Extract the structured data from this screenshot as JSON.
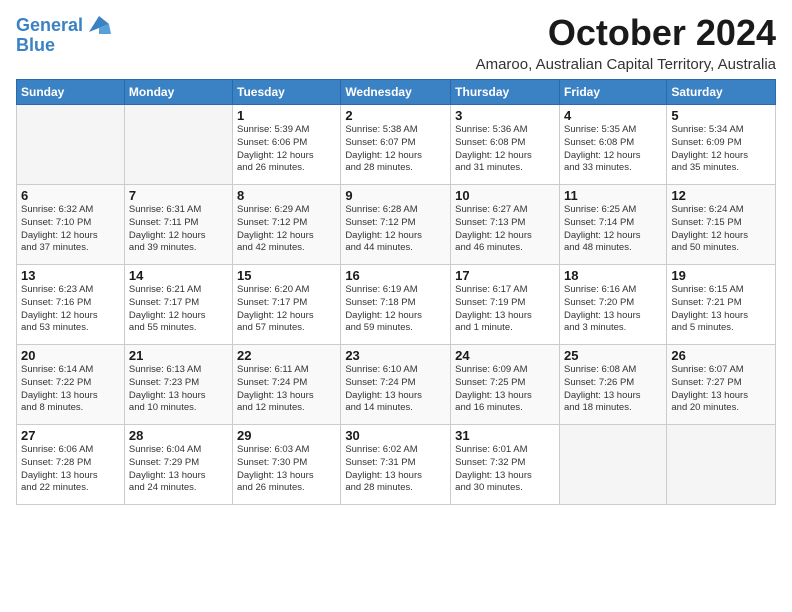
{
  "logo": {
    "line1": "General",
    "line2": "Blue"
  },
  "title": "October 2024",
  "subtitle": "Amaroo, Australian Capital Territory, Australia",
  "days_header": [
    "Sunday",
    "Monday",
    "Tuesday",
    "Wednesday",
    "Thursday",
    "Friday",
    "Saturday"
  ],
  "weeks": [
    [
      {
        "num": "",
        "info": ""
      },
      {
        "num": "",
        "info": ""
      },
      {
        "num": "1",
        "info": "Sunrise: 5:39 AM\nSunset: 6:06 PM\nDaylight: 12 hours\nand 26 minutes."
      },
      {
        "num": "2",
        "info": "Sunrise: 5:38 AM\nSunset: 6:07 PM\nDaylight: 12 hours\nand 28 minutes."
      },
      {
        "num": "3",
        "info": "Sunrise: 5:36 AM\nSunset: 6:08 PM\nDaylight: 12 hours\nand 31 minutes."
      },
      {
        "num": "4",
        "info": "Sunrise: 5:35 AM\nSunset: 6:08 PM\nDaylight: 12 hours\nand 33 minutes."
      },
      {
        "num": "5",
        "info": "Sunrise: 5:34 AM\nSunset: 6:09 PM\nDaylight: 12 hours\nand 35 minutes."
      }
    ],
    [
      {
        "num": "6",
        "info": "Sunrise: 6:32 AM\nSunset: 7:10 PM\nDaylight: 12 hours\nand 37 minutes."
      },
      {
        "num": "7",
        "info": "Sunrise: 6:31 AM\nSunset: 7:11 PM\nDaylight: 12 hours\nand 39 minutes."
      },
      {
        "num": "8",
        "info": "Sunrise: 6:29 AM\nSunset: 7:12 PM\nDaylight: 12 hours\nand 42 minutes."
      },
      {
        "num": "9",
        "info": "Sunrise: 6:28 AM\nSunset: 7:12 PM\nDaylight: 12 hours\nand 44 minutes."
      },
      {
        "num": "10",
        "info": "Sunrise: 6:27 AM\nSunset: 7:13 PM\nDaylight: 12 hours\nand 46 minutes."
      },
      {
        "num": "11",
        "info": "Sunrise: 6:25 AM\nSunset: 7:14 PM\nDaylight: 12 hours\nand 48 minutes."
      },
      {
        "num": "12",
        "info": "Sunrise: 6:24 AM\nSunset: 7:15 PM\nDaylight: 12 hours\nand 50 minutes."
      }
    ],
    [
      {
        "num": "13",
        "info": "Sunrise: 6:23 AM\nSunset: 7:16 PM\nDaylight: 12 hours\nand 53 minutes."
      },
      {
        "num": "14",
        "info": "Sunrise: 6:21 AM\nSunset: 7:17 PM\nDaylight: 12 hours\nand 55 minutes."
      },
      {
        "num": "15",
        "info": "Sunrise: 6:20 AM\nSunset: 7:17 PM\nDaylight: 12 hours\nand 57 minutes."
      },
      {
        "num": "16",
        "info": "Sunrise: 6:19 AM\nSunset: 7:18 PM\nDaylight: 12 hours\nand 59 minutes."
      },
      {
        "num": "17",
        "info": "Sunrise: 6:17 AM\nSunset: 7:19 PM\nDaylight: 13 hours\nand 1 minute."
      },
      {
        "num": "18",
        "info": "Sunrise: 6:16 AM\nSunset: 7:20 PM\nDaylight: 13 hours\nand 3 minutes."
      },
      {
        "num": "19",
        "info": "Sunrise: 6:15 AM\nSunset: 7:21 PM\nDaylight: 13 hours\nand 5 minutes."
      }
    ],
    [
      {
        "num": "20",
        "info": "Sunrise: 6:14 AM\nSunset: 7:22 PM\nDaylight: 13 hours\nand 8 minutes."
      },
      {
        "num": "21",
        "info": "Sunrise: 6:13 AM\nSunset: 7:23 PM\nDaylight: 13 hours\nand 10 minutes."
      },
      {
        "num": "22",
        "info": "Sunrise: 6:11 AM\nSunset: 7:24 PM\nDaylight: 13 hours\nand 12 minutes."
      },
      {
        "num": "23",
        "info": "Sunrise: 6:10 AM\nSunset: 7:24 PM\nDaylight: 13 hours\nand 14 minutes."
      },
      {
        "num": "24",
        "info": "Sunrise: 6:09 AM\nSunset: 7:25 PM\nDaylight: 13 hours\nand 16 minutes."
      },
      {
        "num": "25",
        "info": "Sunrise: 6:08 AM\nSunset: 7:26 PM\nDaylight: 13 hours\nand 18 minutes."
      },
      {
        "num": "26",
        "info": "Sunrise: 6:07 AM\nSunset: 7:27 PM\nDaylight: 13 hours\nand 20 minutes."
      }
    ],
    [
      {
        "num": "27",
        "info": "Sunrise: 6:06 AM\nSunset: 7:28 PM\nDaylight: 13 hours\nand 22 minutes."
      },
      {
        "num": "28",
        "info": "Sunrise: 6:04 AM\nSunset: 7:29 PM\nDaylight: 13 hours\nand 24 minutes."
      },
      {
        "num": "29",
        "info": "Sunrise: 6:03 AM\nSunset: 7:30 PM\nDaylight: 13 hours\nand 26 minutes."
      },
      {
        "num": "30",
        "info": "Sunrise: 6:02 AM\nSunset: 7:31 PM\nDaylight: 13 hours\nand 28 minutes."
      },
      {
        "num": "31",
        "info": "Sunrise: 6:01 AM\nSunset: 7:32 PM\nDaylight: 13 hours\nand 30 minutes."
      },
      {
        "num": "",
        "info": ""
      },
      {
        "num": "",
        "info": ""
      }
    ]
  ]
}
